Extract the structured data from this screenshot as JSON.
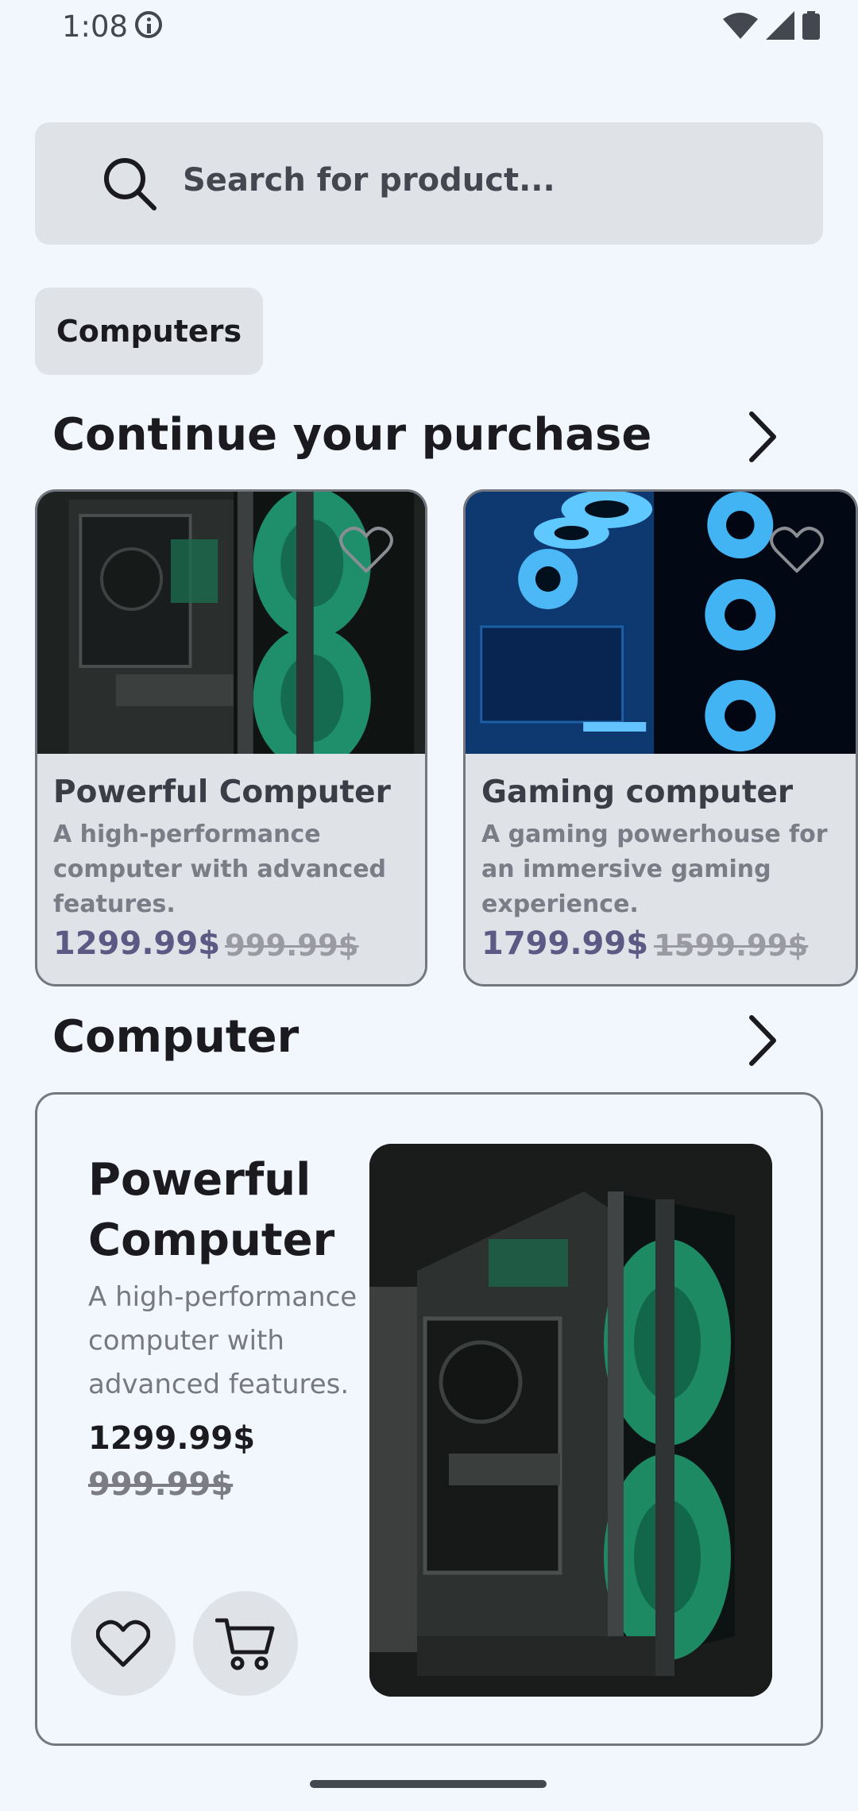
{
  "status_bar": {
    "time": "1:08"
  },
  "search": {
    "placeholder": "Search for product..."
  },
  "category_chip": {
    "label": "Computers"
  },
  "continue_section": {
    "title": "Continue your purchase",
    "cards": [
      {
        "title": "Powerful Computer",
        "description": "A high-performance computer with advanced features.",
        "price": "1299.99$",
        "old_price": "999.99$"
      },
      {
        "title": "Gaming computer",
        "description": "A gaming powerhouse for an immersive gaming experience.",
        "price": "1799.99$",
        "old_price": "1599.99$"
      }
    ]
  },
  "computer_section": {
    "title": "Computer",
    "featured": {
      "title": "Powerful Computer",
      "description": "A high-performance computer with advanced features.",
      "price": "1299.99$",
      "old_price": "999.99$"
    }
  },
  "colors": {
    "background": "#f1f7fd",
    "surface_variant": "#dfe3e8",
    "outline": "#74777f",
    "price_accent": "#5c5a84"
  },
  "icons": [
    "info-icon",
    "wifi-icon",
    "signal-icon",
    "battery-icon",
    "search-icon",
    "chevron-right-icon",
    "heart-icon",
    "cart-icon"
  ]
}
